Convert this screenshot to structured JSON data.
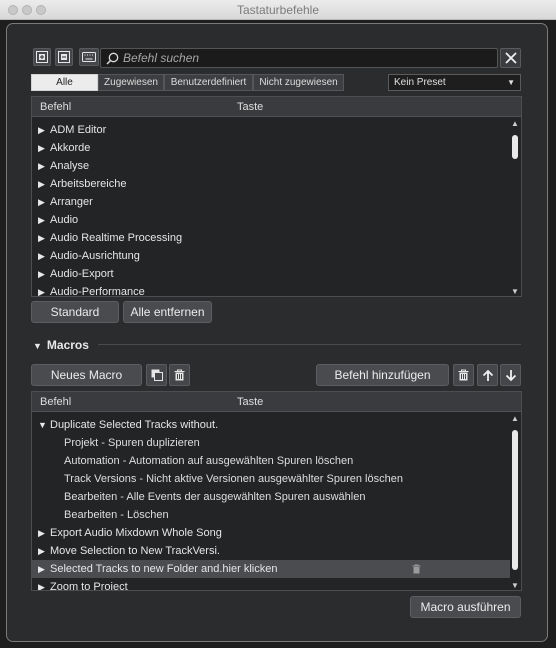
{
  "window": {
    "title": "Tastaturbefehle"
  },
  "toolbar": {
    "search_placeholder": "Befehl suchen"
  },
  "filters": [
    "Alle",
    "Zugewiesen",
    "Benutzerdefiniert",
    "Nicht zugewiesen"
  ],
  "active_filter": "Alle",
  "preset": {
    "value": "Kein Preset"
  },
  "commands": {
    "headers": {
      "command": "Befehl",
      "key": "Taste"
    },
    "items": [
      "ADM Editor",
      "Akkorde",
      "Analyse",
      "Arbeitsbereiche",
      "Arranger",
      "Audio",
      "Audio Realtime Processing",
      "Audio-Ausrichtung",
      "Audio-Export",
      "Audio-Performance"
    ]
  },
  "buttons": {
    "standard": "Standard",
    "remove_all": "Alle entfernen",
    "new_macro": "Neues Macro",
    "add_command": "Befehl hinzufügen",
    "run_macro": "Macro ausführen"
  },
  "macros": {
    "section_label": "Macros",
    "headers": {
      "command": "Befehl",
      "key": "Taste"
    },
    "rows": [
      {
        "label": "Duplicate Selected Tracks without.",
        "level": 0,
        "expanded": true
      },
      {
        "label": "Projekt - Spuren duplizieren",
        "level": 1
      },
      {
        "label": "Automation - Automation auf ausgewählten Spuren löschen",
        "level": 1
      },
      {
        "label": "Track Versions - Nicht aktive Versionen ausgewählter Spuren löschen",
        "level": 1
      },
      {
        "label": "Bearbeiten - Alle Events der ausgewählten Spuren auswählen",
        "level": 1
      },
      {
        "label": "Bearbeiten - Löschen",
        "level": 1
      },
      {
        "label": "Export Audio Mixdown Whole Song",
        "level": 0,
        "expanded": false
      },
      {
        "label": "Move Selection to New TrackVersi.",
        "level": 0,
        "expanded": false
      },
      {
        "label": "Selected Tracks to new Folder and.hier klicken",
        "level": 0,
        "expanded": false,
        "selected": true
      },
      {
        "label": "Zoom to Project",
        "level": 0,
        "expanded": false
      }
    ]
  },
  "colors": {
    "panel": "#2b2c2e",
    "background": "#1e1e1e",
    "selected_row": "#4b4c50",
    "active_tab": "#ececec"
  }
}
